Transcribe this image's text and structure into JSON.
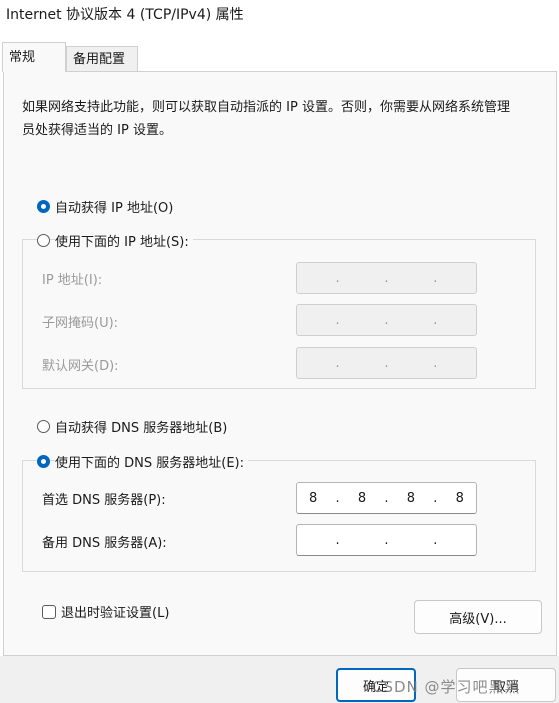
{
  "window": {
    "title": "Internet 协议版本 4 (TCP/IPv4) 属性"
  },
  "tabs": [
    {
      "label": "常规"
    },
    {
      "label": "备用配置"
    }
  ],
  "description": "如果网络支持此功能，则可以获取自动指派的 IP 设置。否则，你需要从网络系统管理员处获得适当的 IP 设置。",
  "ip": {
    "auto_label": "自动获得 IP 地址(O)",
    "manual_label": "使用下面的 IP 地址(S):",
    "auto_selected": true,
    "fields": [
      {
        "label": "IP 地址(I):",
        "octets": [
          "",
          "",
          "",
          ""
        ]
      },
      {
        "label": "子网掩码(U):",
        "octets": [
          "",
          "",
          "",
          ""
        ]
      },
      {
        "label": "默认网关(D):",
        "octets": [
          "",
          "",
          "",
          ""
        ]
      }
    ]
  },
  "dns": {
    "auto_label": "自动获得 DNS 服务器地址(B)",
    "manual_label": "使用下面的 DNS 服务器地址(E):",
    "manual_selected": true,
    "fields": [
      {
        "label": "首选 DNS 服务器(P):",
        "octets": [
          "8",
          "8",
          "8",
          "8"
        ]
      },
      {
        "label": "备用 DNS 服务器(A):",
        "octets": [
          "",
          "",
          "",
          ""
        ]
      }
    ]
  },
  "validate_on_exit_label": "退出时验证设置(L)",
  "advanced_button": "高级(V)...",
  "ok_button": "确定",
  "cancel_button": "取消",
  "watermark": "CSDN @学习吧黑黑",
  "colors": {
    "accent": "#0067c0",
    "panel_bg": "#f9f9f9",
    "disabled_text": "#9a9a9a"
  }
}
